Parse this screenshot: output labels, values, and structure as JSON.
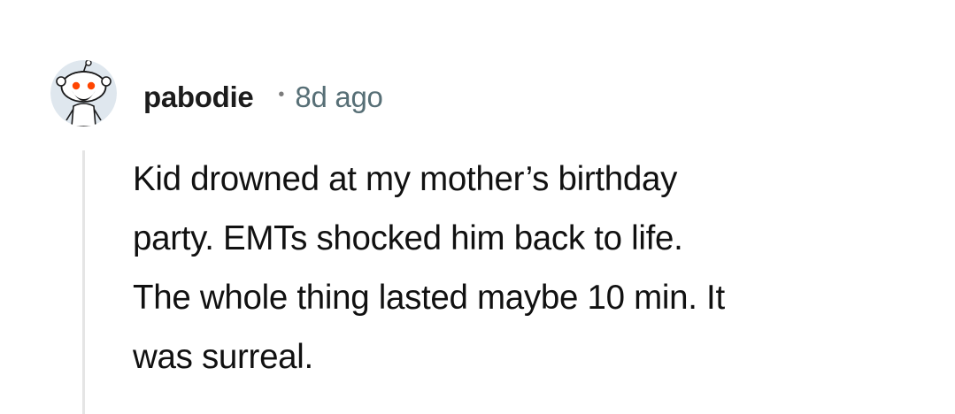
{
  "comment": {
    "author": {
      "username": "pabodie",
      "avatar_icon": "snoo-avatar-icon"
    },
    "separator": "•",
    "timestamp": "8d ago",
    "body_lines": [
      "Kid drowned at my mother’s birthday",
      "party. EMTs shocked him back to life.",
      "The whole thing lasted maybe 10 min. It",
      "was surreal."
    ]
  },
  "colors": {
    "background": "#ffffff",
    "username": "#1c1c1c",
    "timestamp": "#576f76",
    "body_text": "#111111",
    "thread_line": "#e5e5e5",
    "avatar_bg": "#dfe7ee",
    "avatar_accent": "#ff4500"
  }
}
